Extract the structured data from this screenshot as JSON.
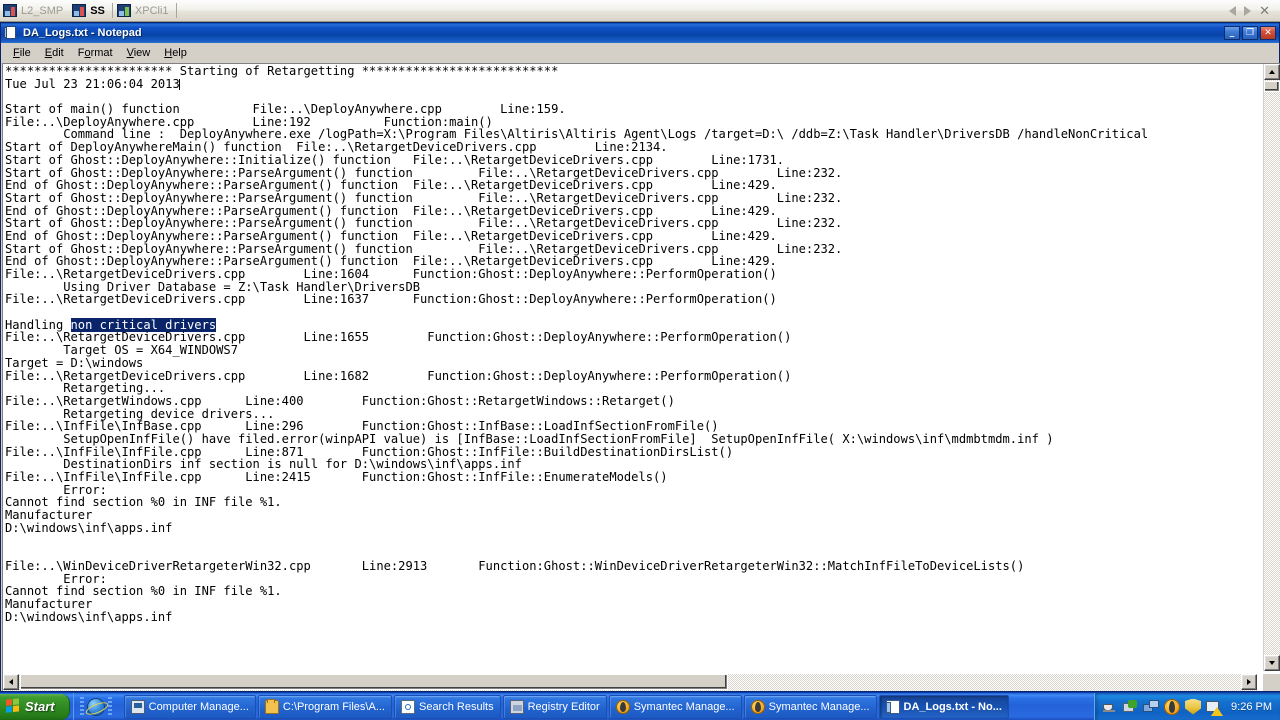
{
  "connection_bar": {
    "tabs": [
      {
        "label": "L2_SMP",
        "state": "inactive",
        "icon": "remote-desktop-icon"
      },
      {
        "label": "SS",
        "state": "active",
        "icon": "remote-desktop-icon"
      },
      {
        "label": "XPCli1",
        "state": "inactive",
        "icon": "remote-desktop-icon"
      }
    ],
    "nav_prev": "◁",
    "nav_next": "▷",
    "close": "✕"
  },
  "window": {
    "title": "DA_Logs.txt - Notepad",
    "minimize_label": "_",
    "maximize_label": "❐",
    "close_label": "✕"
  },
  "menu": {
    "items": [
      {
        "label": "File",
        "accel": "F"
      },
      {
        "label": "Edit",
        "accel": "E"
      },
      {
        "label": "Format",
        "accel": "o"
      },
      {
        "label": "View",
        "accel": "V"
      },
      {
        "label": "Help",
        "accel": "H"
      }
    ]
  },
  "document": {
    "selection_text": "non critical drivers",
    "lines": [
      {
        "text": "*********************** Starting of Retargetting ***************************"
      },
      {
        "text": "Tue Jul 23 21:06:04 2013",
        "caret_after": true
      },
      {
        "text": ""
      },
      {
        "text": "Start of main() function          File:..\\DeployAnywhere.cpp        Line:159."
      },
      {
        "text": "File:..\\DeployAnywhere.cpp        Line:192          Function:main()"
      },
      {
        "text": "        Command line :  DeployAnywhere.exe /logPath=X:\\Program Files\\Altiris\\Altiris Agent\\Logs /target=D:\\ /ddb=Z:\\Task Handler\\DriversDB /handleNonCritical"
      },
      {
        "text": "Start of DeployAnywhereMain() function  File:..\\RetargetDeviceDrivers.cpp        Line:2134."
      },
      {
        "text": "Start of Ghost::DeployAnywhere::Initialize() function   File:..\\RetargetDeviceDrivers.cpp        Line:1731."
      },
      {
        "text": "Start of Ghost::DeployAnywhere::ParseArgument() function         File:..\\RetargetDeviceDrivers.cpp        Line:232."
      },
      {
        "text": "End of Ghost::DeployAnywhere::ParseArgument() function  File:..\\RetargetDeviceDrivers.cpp        Line:429."
      },
      {
        "text": "Start of Ghost::DeployAnywhere::ParseArgument() function         File:..\\RetargetDeviceDrivers.cpp        Line:232."
      },
      {
        "text": "End of Ghost::DeployAnywhere::ParseArgument() function  File:..\\RetargetDeviceDrivers.cpp        Line:429."
      },
      {
        "text": "Start of Ghost::DeployAnywhere::ParseArgument() function         File:..\\RetargetDeviceDrivers.cpp        Line:232."
      },
      {
        "text": "End of Ghost::DeployAnywhere::ParseArgument() function  File:..\\RetargetDeviceDrivers.cpp        Line:429."
      },
      {
        "text": "Start of Ghost::DeployAnywhere::ParseArgument() function         File:..\\RetargetDeviceDrivers.cpp        Line:232."
      },
      {
        "text": "End of Ghost::DeployAnywhere::ParseArgument() function  File:..\\RetargetDeviceDrivers.cpp        Line:429."
      },
      {
        "text": "File:..\\RetargetDeviceDrivers.cpp        Line:1604      Function:Ghost::DeployAnywhere::PerformOperation()"
      },
      {
        "text": "        Using Driver Database = Z:\\Task Handler\\DriversDB"
      },
      {
        "text": "File:..\\RetargetDeviceDrivers.cpp        Line:1637      Function:Ghost::DeployAnywhere::PerformOperation()"
      },
      {
        "text": ""
      },
      {
        "text": "Handling ",
        "selection": "non critical drivers"
      },
      {
        "text": "File:..\\RetargetDeviceDrivers.cpp        Line:1655        Function:Ghost::DeployAnywhere::PerformOperation()"
      },
      {
        "text": "        Target OS = X64_WINDOWS7"
      },
      {
        "text": "Target = D:\\windows"
      },
      {
        "text": "File:..\\RetargetDeviceDrivers.cpp        Line:1682        Function:Ghost::DeployAnywhere::PerformOperation()"
      },
      {
        "text": "        Retargeting..."
      },
      {
        "text": "File:..\\RetargetWindows.cpp      Line:400        Function:Ghost::RetargetWindows::Retarget()"
      },
      {
        "text": "        Retargeting device drivers..."
      },
      {
        "text": "File:..\\InfFile\\InfBase.cpp      Line:296        Function:Ghost::InfBase::LoadInfSectionFromFile()"
      },
      {
        "text": "        SetupOpenInfFile() have filed.error(winpAPI value) is [InfBase::LoadInfSectionFromFile]  SetupOpenInfFile( X:\\windows\\inf\\mdmbtmdm.inf )"
      },
      {
        "text": "File:..\\InfFile\\InfFile.cpp      Line:871        Function:Ghost::InfFile::BuildDestinationDirsList()"
      },
      {
        "text": "        DestinationDirs inf section is null for D:\\windows\\inf\\apps.inf"
      },
      {
        "text": "File:..\\InfFile\\InfFile.cpp      Line:2415       Function:Ghost::InfFile::EnumerateModels()"
      },
      {
        "text": "        Error:"
      },
      {
        "text": "Cannot find section %0 in INF file %1."
      },
      {
        "text": "Manufacturer"
      },
      {
        "text": "D:\\windows\\inf\\apps.inf"
      },
      {
        "text": ""
      },
      {
        "text": ""
      },
      {
        "text": "File:..\\WinDeviceDriverRetargeterWin32.cpp       Line:2913       Function:Ghost::WinDeviceDriverRetargeterWin32::MatchInfFileToDeviceLists()"
      },
      {
        "text": "        Error:"
      },
      {
        "text": "Cannot find section %0 in INF file %1."
      },
      {
        "text": "Manufacturer"
      },
      {
        "text": "D:\\windows\\inf\\apps.inf"
      }
    ]
  },
  "taskbar": {
    "start_label": "Start",
    "quicklaunch": [
      {
        "name": "internet-explorer-icon"
      }
    ],
    "tasks": [
      {
        "label": "Computer Manage...",
        "icon": "computer-management-icon",
        "active": false
      },
      {
        "label": "C:\\Program Files\\A...",
        "icon": "folder-icon",
        "active": false
      },
      {
        "label": "Search Results",
        "icon": "search-results-icon",
        "active": false
      },
      {
        "label": "Registry Editor",
        "icon": "registry-editor-icon",
        "active": false
      },
      {
        "label": "Symantec Manage...",
        "icon": "symantec-icon",
        "active": false
      },
      {
        "label": "Symantec Manage...",
        "icon": "symantec-icon",
        "active": false
      },
      {
        "label": "DA_Logs.txt - No...",
        "icon": "notepad-icon",
        "active": true
      }
    ],
    "tray_icons": [
      {
        "name": "safely-remove-hardware-icon"
      },
      {
        "name": "network-install-icon"
      },
      {
        "name": "network-connection-icon"
      },
      {
        "name": "symantec-tray-icon"
      },
      {
        "name": "security-shield-icon"
      },
      {
        "name": "vpn-warning-icon"
      }
    ],
    "clock": "9:26 PM"
  },
  "colors": {
    "titlebar_blue": "#0a4bb5",
    "selection_blue": "#0a246a",
    "window_face": "#d4d0c8",
    "taskbar_blue": "#2362d8",
    "start_green": "#2f8a21"
  }
}
